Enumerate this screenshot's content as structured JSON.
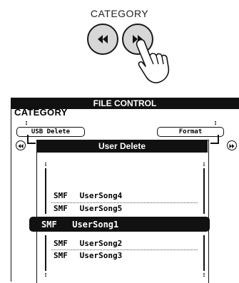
{
  "panel": {
    "category_label": "CATEGORY",
    "left_button_icon": "rewind-icon",
    "right_button_icon": "fast-forward-icon",
    "pointer_icon": "pressing-hand-icon"
  },
  "screen": {
    "title": "FILE CONTROL",
    "heading": "CATEGORY",
    "usb_delete_label": "USB Delete",
    "format_label": "Format",
    "dialog_title": "User Delete",
    "files_above": [
      {
        "type": "SMF",
        "name": "UserSong4"
      },
      {
        "type": "SMF",
        "name": "UserSong5"
      }
    ],
    "selected_file": {
      "type": "SMF",
      "name": "UserSong1"
    },
    "files_below": [
      {
        "type": "SMF",
        "name": "UserSong2"
      },
      {
        "type": "SMF",
        "name": "UserSong3"
      }
    ]
  }
}
